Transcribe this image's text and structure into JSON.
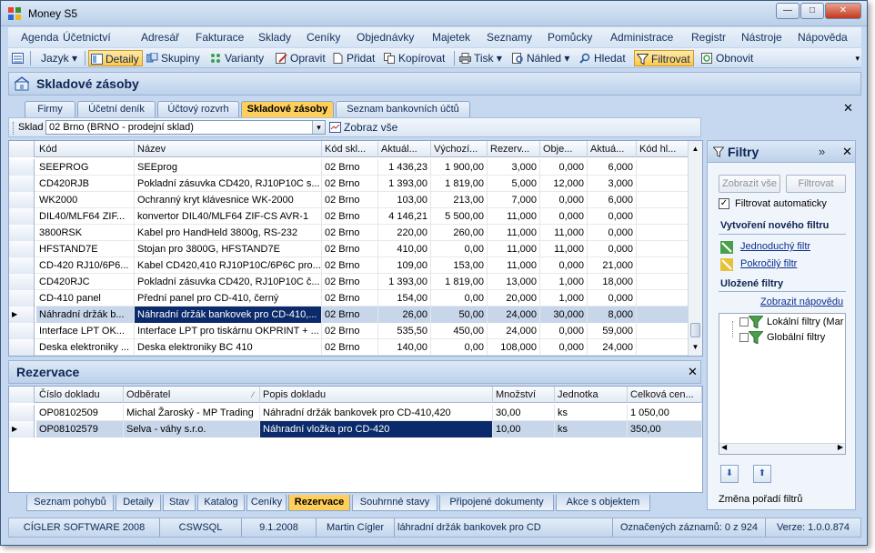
{
  "window": {
    "title": "Money S5"
  },
  "menu": [
    "Agenda",
    "Účetnictví",
    "Adresář",
    "Fakturace",
    "Sklady",
    "Ceníky",
    "Objednávky",
    "Majetek",
    "Seznamy",
    "Pomůcky",
    "Administrace",
    "Registr",
    "Nástroje",
    "Nápověda"
  ],
  "toolbar": {
    "jazyk": "Jazyk",
    "detaily": "Detaily",
    "skupiny": "Skupiny",
    "varianty": "Varianty",
    "opravit": "Opravit",
    "pridat": "Přidat",
    "kopirovat": "Kopírovat",
    "tisk": "Tisk",
    "nahled": "Náhled",
    "hledat": "Hledat",
    "filtrovat": "Filtrovat",
    "obnovit": "Obnovit"
  },
  "page": {
    "title": "Skladové zásoby"
  },
  "top_tabs": [
    "Firmy",
    "Účetní deník",
    "Účtový rozvrh",
    "Skladové zásoby",
    "Seznam bankovních účtů"
  ],
  "filter": {
    "sklad_label": "Sklad",
    "sklad_value": "02 Brno (BRNO -  prodejní sklad)",
    "zobraz_vse": "Zobraz vše"
  },
  "grid": {
    "columns": [
      "Kód",
      "Název",
      "Kód skl...",
      "Aktuál...",
      "Výchozí...",
      "Rezerv...",
      "Obje...",
      "Aktuá...",
      "Kód hl..."
    ],
    "rows": [
      [
        "SEEPROG",
        "SEEprog",
        "02 Brno",
        "1 436,23",
        "1 900,00",
        "3,000",
        "0,000",
        "6,000",
        ""
      ],
      [
        "CD420RJB",
        "Pokladní zásuvka CD420, RJ10P10C s...",
        "02 Brno",
        "1 393,00",
        "1 819,00",
        "5,000",
        "12,000",
        "3,000",
        ""
      ],
      [
        "WK2000",
        "Ochranný kryt klávesnice WK-2000",
        "02 Brno",
        "103,00",
        "213,00",
        "7,000",
        "0,000",
        "6,000",
        ""
      ],
      [
        "DIL40/MLF64 ZIF...",
        "konvertor DIL40/MLF64 ZIF-CS AVR-1",
        "02 Brno",
        "4 146,21",
        "5 500,00",
        "11,000",
        "0,000",
        "0,000",
        ""
      ],
      [
        "3800RSK",
        "Kabel pro HandHeld 3800g, RS-232",
        "02 Brno",
        "220,00",
        "260,00",
        "11,000",
        "11,000",
        "0,000",
        ""
      ],
      [
        "HFSTAND7E",
        "Stojan pro 3800G, HFSTAND7E",
        "02 Brno",
        "410,00",
        "0,00",
        "11,000",
        "11,000",
        "0,000",
        ""
      ],
      [
        "CD-420 RJ10/6P6...",
        "Kabel CD420,410 RJ10P10C/6P6C pro...",
        "02 Brno",
        "109,00",
        "153,00",
        "11,000",
        "0,000",
        "21,000",
        ""
      ],
      [
        "CD420RJC",
        "Pokladní zásuvka CD420, RJ10P10C č...",
        "02 Brno",
        "1 393,00",
        "1 819,00",
        "13,000",
        "1,000",
        "18,000",
        ""
      ],
      [
        "CD-410 panel",
        "Přední panel pro CD-410, černý",
        "02 Brno",
        "154,00",
        "0,00",
        "20,000",
        "1,000",
        "0,000",
        ""
      ],
      [
        "Náhradní držák b...",
        "Náhradní držák bankovek pro CD-410,...",
        "02 Brno",
        "26,00",
        "50,00",
        "24,000",
        "30,000",
        "8,000",
        ""
      ],
      [
        "Interface LPT OK...",
        "Interface LPT pro tiskárnu OKPRINT + ...",
        "02 Brno",
        "535,50",
        "450,00",
        "24,000",
        "0,000",
        "59,000",
        ""
      ],
      [
        "Deska elektroniky ...",
        "Deska elektroniky BC 410",
        "02 Brno",
        "140,00",
        "0,00",
        "108,000",
        "0,000",
        "24,000",
        ""
      ]
    ]
  },
  "rezervace": {
    "title": "Rezervace",
    "columns": [
      "Číslo dokladu",
      "Odběratel",
      "Popis dokladu",
      "Množství",
      "Jednotka",
      "Celková cen..."
    ],
    "rows": [
      [
        "OP08102509",
        "Michal Žaroský - MP Trading",
        "Náhradní držák bankovek pro CD-410,420",
        "30,00",
        "ks",
        "1 050,00"
      ],
      [
        "OP08102579",
        "Selva - váhy s.r.o.",
        "Náhradní vložka pro CD-420",
        "10,00",
        "ks",
        "350,00"
      ]
    ]
  },
  "bottom_tabs": [
    "Seznam pohybů",
    "Detaily",
    "Stav",
    "Katalog",
    "Ceníky",
    "Rezervace",
    "Souhrnné stavy",
    "Připojené dokumenty",
    "Akce s objektem"
  ],
  "filtry": {
    "title": "Filtry",
    "zobrazit_vse": "Zobrazit vše",
    "filtrovat": "Filtrovat",
    "auto": "Filtrovat automaticky",
    "novy": "Vytvoření nového filtru",
    "jednoduchy": "Jednoduchý filtr",
    "pokrocily": "Pokročilý filtr",
    "ulozene": "Uložené filtry",
    "napoveda": "Zobrazit nápovědu",
    "lokalni": "Lokální filtry (Mar",
    "globalni": "Globální filtry",
    "zmena": "Změna pořadí filtrů"
  },
  "status": [
    "CÍGLER SOFTWARE 2008",
    "CSWSQL",
    "9.1.2008",
    "Martin Cígler",
    "láhradní držák bankovek pro CD",
    "Označených záznamů: 0 z 924",
    "Verze: 1.0.0.874"
  ]
}
